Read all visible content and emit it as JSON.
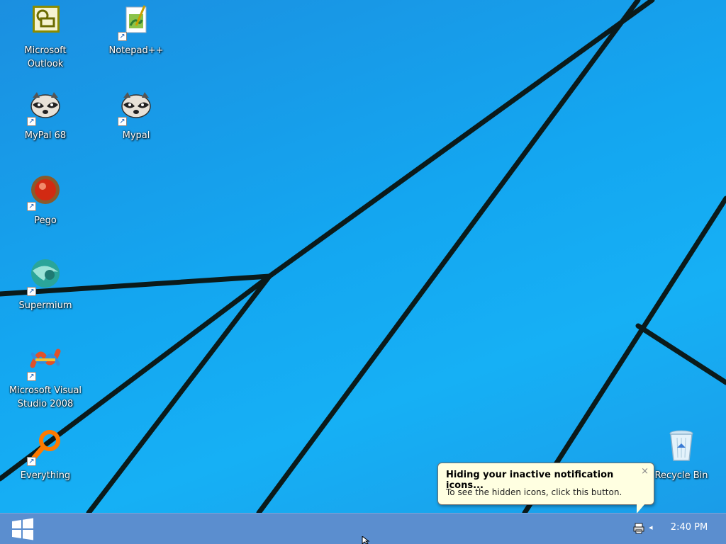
{
  "desktop": {
    "icons": [
      {
        "label": "Microsoft Outlook",
        "icon": "outlook-icon",
        "shortcut": false
      },
      {
        "label": "Notepad++",
        "icon": "notepad-plus-plus-icon",
        "shortcut": true
      },
      {
        "label": "MyPal 68",
        "icon": "mypal-raccoon-icon",
        "shortcut": true
      },
      {
        "label": "Mypal",
        "icon": "mypal-raccoon-icon",
        "shortcut": true
      },
      {
        "label": "Pego",
        "icon": "pego-icon",
        "shortcut": true
      },
      {
        "label": "Supermium",
        "icon": "supermium-icon",
        "shortcut": true
      },
      {
        "label": "Microsoft Visual Studio 2008",
        "icon": "visual-studio-icon",
        "shortcut": true
      },
      {
        "label": "Everything",
        "icon": "everything-search-icon",
        "shortcut": true
      },
      {
        "label": "Recycle Bin",
        "icon": "recycle-bin-icon",
        "shortcut": false
      }
    ]
  },
  "notification": {
    "title": "Hiding your inactive notification icons...",
    "text": "To see the hidden icons, click this button.",
    "close": "×"
  },
  "taskbar": {
    "start_icon": "windows-logo-icon",
    "tray_chevron": "◂",
    "clock": "2:40 PM"
  },
  "colors": {
    "wallpaper": "#16a4ee",
    "taskbar": "#5b8ecf",
    "balloon": "#ffffe1"
  }
}
